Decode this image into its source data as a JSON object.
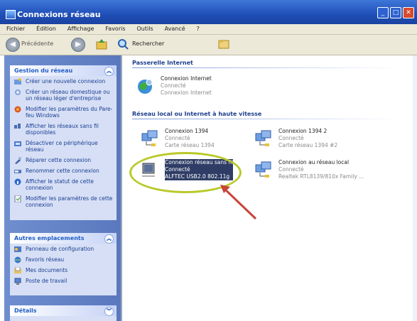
{
  "window": {
    "title": "Connexions réseau"
  },
  "menu": [
    "Fichier",
    "Édition",
    "Affichage",
    "Favoris",
    "Outils",
    "Avancé",
    "?"
  ],
  "toolbar": {
    "back_label": "Précédente",
    "search_label": "Rechercher"
  },
  "sidebar": {
    "network_tasks": {
      "title": "Gestion du réseau",
      "items": [
        {
          "label": "Créer une nouvelle connexion",
          "icon": "new-connection-icon"
        },
        {
          "label": "Créer un réseau domestique ou un réseau léger d'entreprise",
          "icon": "home-network-icon"
        },
        {
          "label": "Modifier les paramètres du Pare-feu Windows",
          "icon": "firewall-icon"
        },
        {
          "label": "Afficher les réseaux sans fil disponibles",
          "icon": "wireless-icon"
        },
        {
          "label": "Désactiver ce périphérique réseau",
          "icon": "disable-device-icon"
        },
        {
          "label": "Réparer cette connexion",
          "icon": "repair-icon"
        },
        {
          "label": "Renommer cette connexion",
          "icon": "rename-icon"
        },
        {
          "label": "Afficher le statut de cette connexion",
          "icon": "status-icon"
        },
        {
          "label": "Modifier les paramètres de cette connexion",
          "icon": "settings-icon"
        }
      ]
    },
    "other_places": {
      "title": "Autres emplacements",
      "items": [
        {
          "label": "Panneau de configuration",
          "icon": "control-panel-icon"
        },
        {
          "label": "Favoris réseau",
          "icon": "network-places-icon"
        },
        {
          "label": "Mes documents",
          "icon": "my-documents-icon"
        },
        {
          "label": "Poste de travail",
          "icon": "my-computer-icon"
        }
      ]
    },
    "details": {
      "title": "Détails"
    }
  },
  "content": {
    "gateway_group": {
      "title": "Passerelle Internet",
      "items": [
        {
          "name": "Connexion Internet",
          "status": "Connecté",
          "device": "Connexion Internet"
        }
      ]
    },
    "lan_group": {
      "title": "Réseau local ou Internet à haute vitesse",
      "items": [
        {
          "name": "Connexion 1394",
          "status": "Connecté",
          "device": "Carte réseau 1394"
        },
        {
          "name": "Connexion 1394 2",
          "status": "Connecté",
          "device": "Carte réseau 1394 #2"
        },
        {
          "name": "Connexion réseau sans fil",
          "status": "Connecté",
          "device": "ALFTEC USB2.0 802.11g"
        },
        {
          "name": "Connexion au réseau local",
          "status": "Connecté",
          "device": "Realtek RTL8139/810x Family ..."
        }
      ]
    }
  },
  "colors": {
    "title_bar": "#1f4fb8",
    "sidebar": "#6f8ecf",
    "highlight": "#b9c92a",
    "arrow": "#c8443a"
  }
}
